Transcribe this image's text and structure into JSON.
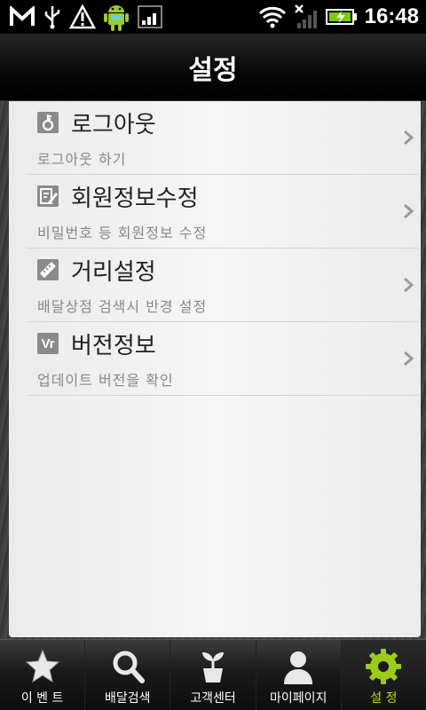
{
  "status_bar": {
    "time": "16:48",
    "icons": [
      "gmail-icon",
      "usb-icon",
      "warning-icon",
      "android-icon",
      "signal-app-icon",
      "wifi-icon",
      "no-signal-icon",
      "battery-charging-icon"
    ]
  },
  "header": {
    "title": "설정"
  },
  "settings": {
    "items": [
      {
        "icon": "key-icon",
        "label": "로그아웃",
        "description": "로그아웃 하기"
      },
      {
        "icon": "edit-profile-icon",
        "label": "회원정보수정",
        "description": "비밀번호 등 회원정보 수정"
      },
      {
        "icon": "ruler-icon",
        "label": "거리설정",
        "description": "배달상점 검색시 반경 설정"
      },
      {
        "icon": "version-icon",
        "icon_text": "Vr",
        "label": "버전정보",
        "description": "업데이트 버전을 확인"
      }
    ]
  },
  "tabs": [
    {
      "icon": "star-icon",
      "label": "이 벤 트"
    },
    {
      "icon": "search-icon",
      "label": "배달검색"
    },
    {
      "icon": "plant-icon",
      "label": "고객센터"
    },
    {
      "icon": "person-icon",
      "label": "마이페이지"
    },
    {
      "icon": "gear-icon",
      "label": "설  정",
      "active": true
    }
  ],
  "colors": {
    "active_tab": "#b6e01a",
    "header_bg": "#000000",
    "panel_bg": "#f2f2f2"
  }
}
